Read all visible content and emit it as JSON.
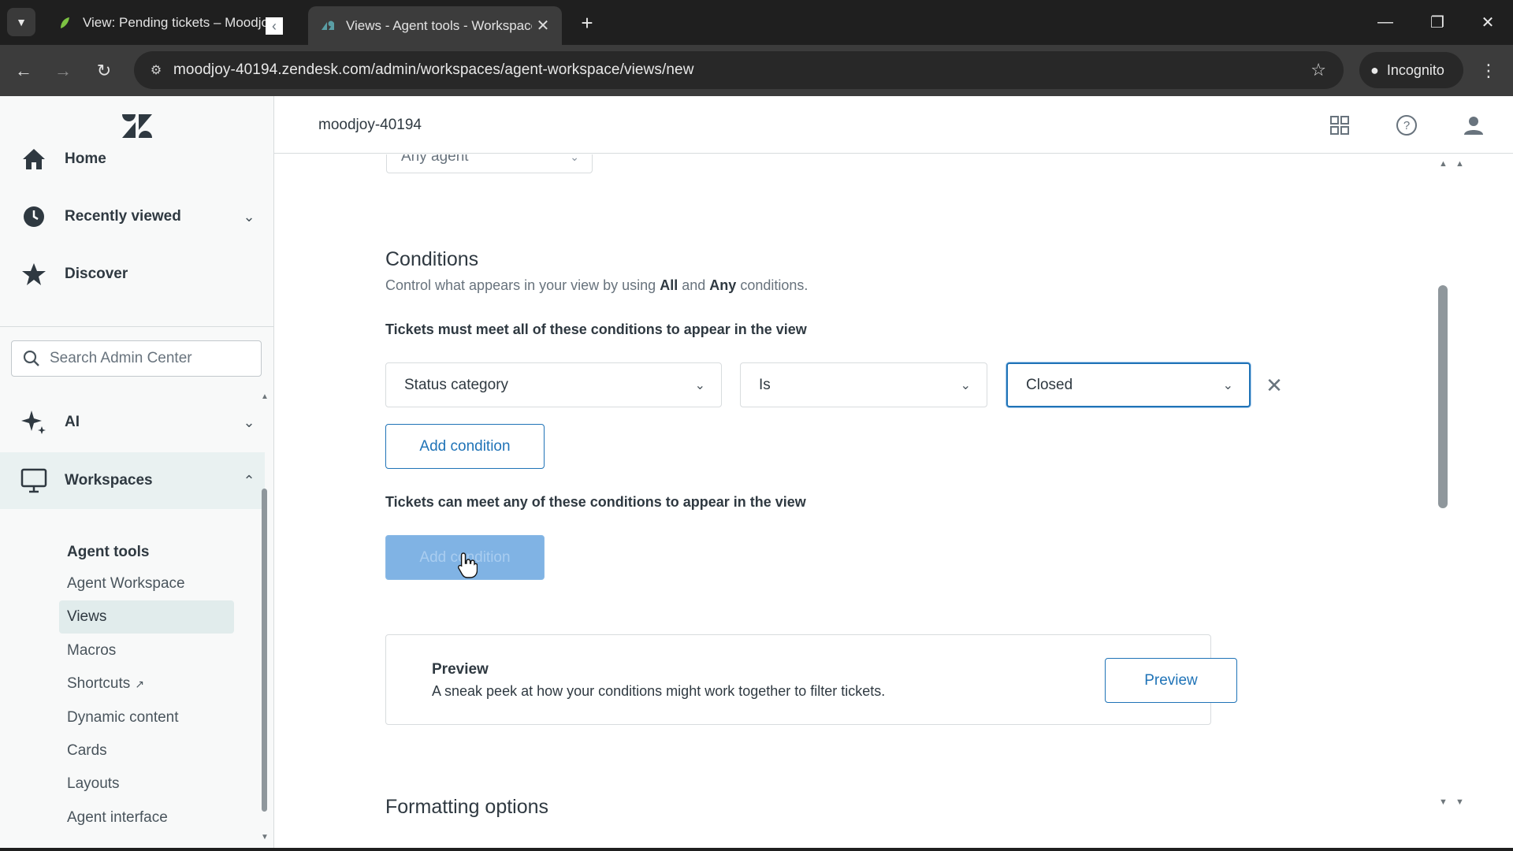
{
  "browser": {
    "tabs": [
      {
        "title": "View: Pending tickets – Moodjoy",
        "active": false
      },
      {
        "title": "Views - Agent tools - Workspaces",
        "active": true
      }
    ],
    "url": "moodjoy-40194.zendesk.com/admin/workspaces/agent-workspace/views/new",
    "incognito_label": "Incognito"
  },
  "header": {
    "account_name": "moodjoy-40194"
  },
  "sidebar": {
    "nav": {
      "home": "Home",
      "recently_viewed": "Recently viewed",
      "discover": "Discover",
      "ai": "AI",
      "workspaces": "Workspaces"
    },
    "search_placeholder": "Search Admin Center",
    "group_title": "Agent tools",
    "sub_items": {
      "agent_workspace": "Agent Workspace",
      "views": "Views",
      "macros": "Macros",
      "shortcuts": "Shortcuts",
      "dynamic_content": "Dynamic content",
      "cards": "Cards",
      "layouts": "Layouts",
      "agent_interface": "Agent interface"
    }
  },
  "main": {
    "agent_select_value": "Any agent",
    "conditions": {
      "title": "Conditions",
      "desc_prefix": "Control what appears in your view by using",
      "desc_all": "All",
      "desc_and": "and",
      "desc_any": "Any",
      "desc_suffix": "conditions.",
      "all_heading": "Tickets must meet all of these conditions to appear in the view",
      "any_heading": "Tickets can meet any of these conditions to appear in the view",
      "row": {
        "field": "Status category",
        "operator": "Is",
        "value": "Closed"
      },
      "add_condition_label": "Add condition"
    },
    "preview": {
      "title": "Preview",
      "desc": "A sneak peek at how your conditions might work together to filter tickets.",
      "button_label": "Preview"
    },
    "formatting_title": "Formatting options"
  },
  "colors": {
    "accent": "#1f73b7",
    "zendesk_green": "#03363d"
  }
}
